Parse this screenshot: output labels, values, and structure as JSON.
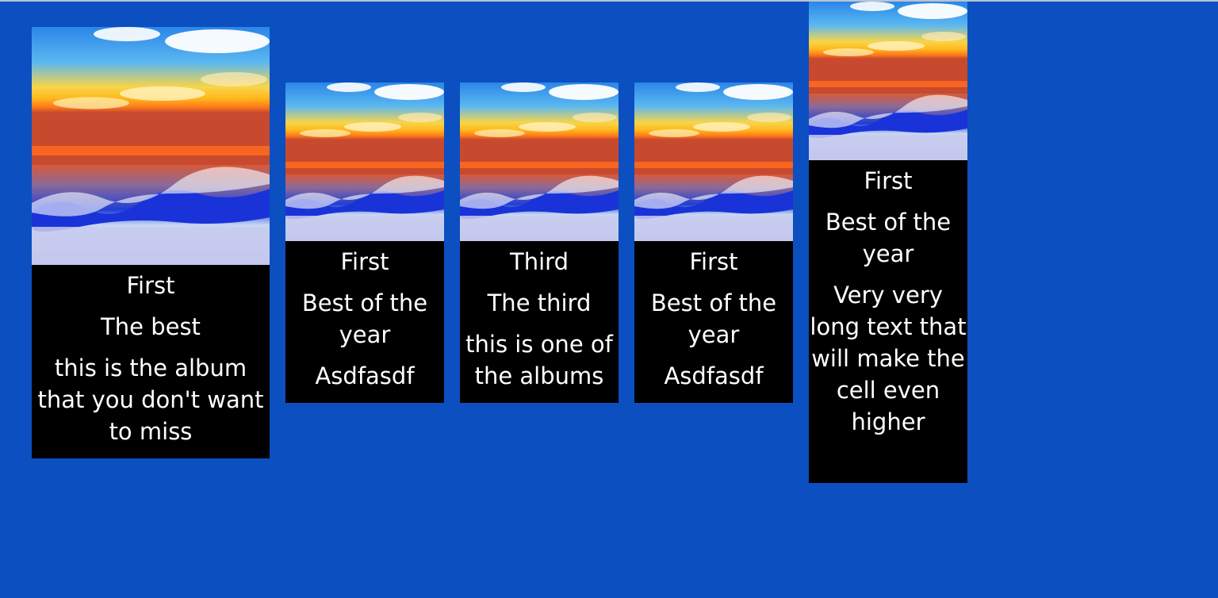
{
  "albums": [
    {
      "title": "First",
      "subtitle": "The best",
      "description": "this is the album that you don't want to miss"
    },
    {
      "title": "First",
      "subtitle": "Best of the year",
      "description": "Asdfasdf"
    },
    {
      "title": "Third",
      "subtitle": "The third",
      "description": "this is one of the albums"
    },
    {
      "title": "First",
      "subtitle": "Best of the year",
      "description": "Asdfasdf"
    },
    {
      "title": "First",
      "subtitle": "Best of the year",
      "description": "Very very long text that will make the cell even higher"
    }
  ],
  "colors": {
    "background": "#0b4fc1",
    "card": "#000000",
    "text": "#ffffff"
  },
  "icons": {
    "album_art": "beach-sunset-image"
  }
}
